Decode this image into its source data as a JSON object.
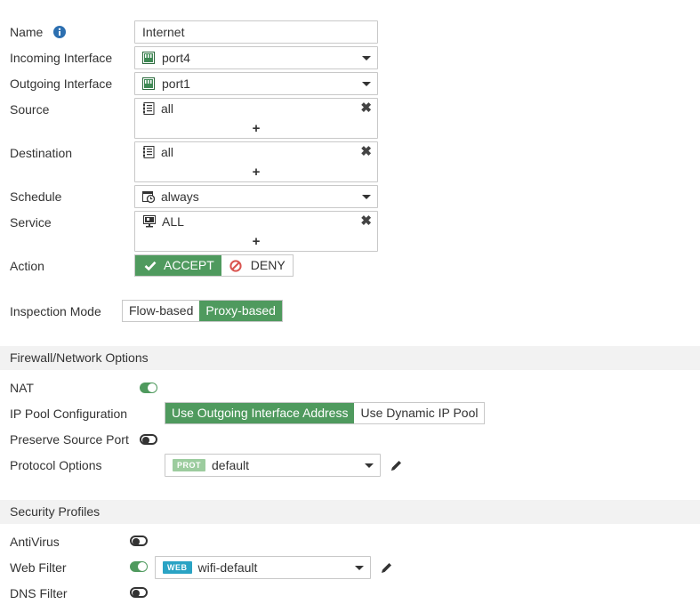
{
  "policy": {
    "name_label": "Name",
    "name_value": "Internet",
    "incoming_label": "Incoming Interface",
    "incoming_value": "port4",
    "outgoing_label": "Outgoing Interface",
    "outgoing_value": "port1",
    "source_label": "Source",
    "source_value": "all",
    "destination_label": "Destination",
    "destination_value": "all",
    "schedule_label": "Schedule",
    "schedule_value": "always",
    "service_label": "Service",
    "service_value": "ALL",
    "action_label": "Action",
    "action_accept": "ACCEPT",
    "action_deny": "DENY",
    "action_selected": "ACCEPT",
    "add_symbol": "+",
    "remove_symbol": "✖"
  },
  "inspection": {
    "label": "Inspection Mode",
    "flow": "Flow-based",
    "proxy": "Proxy-based",
    "selected": "Proxy-based"
  },
  "firewall": {
    "section_title": "Firewall/Network Options",
    "nat_label": "NAT",
    "nat_enabled": true,
    "ip_pool_label": "IP Pool Configuration",
    "ip_pool_outgoing": "Use Outgoing Interface Address",
    "ip_pool_dynamic": "Use Dynamic IP Pool",
    "ip_pool_selected": "Use Outgoing Interface Address",
    "preserve_label": "Preserve Source Port",
    "preserve_enabled": false,
    "protocol_label": "Protocol Options",
    "protocol_badge": "PROT",
    "protocol_value": "default"
  },
  "security": {
    "section_title": "Security Profiles",
    "antivirus_label": "AntiVirus",
    "antivirus_enabled": false,
    "webfilter_label": "Web Filter",
    "webfilter_enabled": true,
    "webfilter_badge": "WEB",
    "webfilter_value": "wifi-default",
    "dnsfilter_label": "DNS Filter",
    "dnsfilter_enabled": false
  },
  "colors": {
    "accent_green": "#4f9a5e",
    "prot_badge": "#9ccc9e",
    "web_badge": "#2aa3c4",
    "info_blue": "#2c6fb0",
    "deny_red": "#d9534f"
  },
  "icons": {
    "interface": "port-icon",
    "address": "address-book-icon",
    "schedule": "clock-calendar-icon",
    "service": "monitor-service-icon",
    "edit": "pencil-icon",
    "info": "info-icon"
  }
}
